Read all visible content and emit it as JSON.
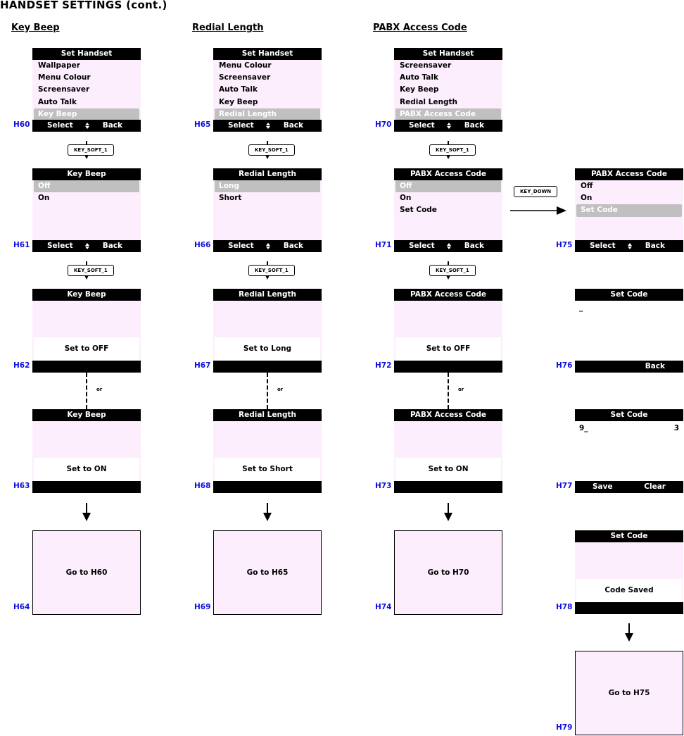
{
  "page_title": "HANDSET SETTINGS (cont.)",
  "sections": [
    {
      "title": "Key Beep"
    },
    {
      "title": "Redial Length"
    },
    {
      "title": "PABX Access Code"
    }
  ],
  "key_labels": {
    "soft1": "KEY_SOFT_1",
    "down": "KEY_DOWN"
  },
  "or_label": "or",
  "softkeys": {
    "select": "Select",
    "back": "Back",
    "nav": "▲▼",
    "save": "Save",
    "clear": "Clear"
  },
  "screens": {
    "H60": {
      "id": "H60",
      "title": "Set Handset",
      "items": [
        "Wallpaper",
        "Menu Colour",
        "Screensaver",
        "Auto Talk",
        "Key Beep"
      ],
      "selected": 4
    },
    "H61": {
      "id": "H61",
      "title": "Key Beep",
      "items": [
        "Off",
        "On"
      ],
      "selected": 0
    },
    "H62": {
      "id": "H62",
      "title": "Key Beep",
      "message": "Set to OFF"
    },
    "H63": {
      "id": "H63",
      "title": "Key Beep",
      "message": "Set to ON"
    },
    "H64": {
      "id": "H64",
      "message": "Go to H60"
    },
    "H65": {
      "id": "H65",
      "title": "Set Handset",
      "items": [
        "Menu Colour",
        "Screensaver",
        "Auto Talk",
        "Key Beep",
        "Redial Length"
      ],
      "selected": 4
    },
    "H66": {
      "id": "H66",
      "title": "Redial Length",
      "items": [
        "Long",
        "Short"
      ],
      "selected": 0
    },
    "H67": {
      "id": "H67",
      "title": "Redial Length",
      "message": "Set to Long"
    },
    "H68": {
      "id": "H68",
      "title": "Redial Length",
      "message": "Set to Short"
    },
    "H69": {
      "id": "H69",
      "message": "Go to H65"
    },
    "H70": {
      "id": "H70",
      "title": "Set Handset",
      "items": [
        "Screensaver",
        "Auto Talk",
        "Key Beep",
        "Redial Length",
        "PABX Access Code"
      ],
      "selected": 4
    },
    "H71": {
      "id": "H71",
      "title": "PABX Access Code",
      "items": [
        "Off",
        "On",
        "Set Code"
      ],
      "selected": 0
    },
    "H72": {
      "id": "H72",
      "title": "PABX Access Code",
      "message": "Set to OFF"
    },
    "H73": {
      "id": "H73",
      "title": "PABX Access Code",
      "message": "Set to ON"
    },
    "H74": {
      "id": "H74",
      "message": "Go to H70"
    },
    "H75": {
      "id": "H75",
      "title": "PABX Access Code",
      "items": [
        "Off",
        "On",
        "Set Code"
      ],
      "selected": 2
    },
    "H76": {
      "id": "H76",
      "title": "Set Code",
      "entry": "_"
    },
    "H77": {
      "id": "H77",
      "title": "Set Code",
      "entry": "9_",
      "count": "3"
    },
    "H78": {
      "id": "H78",
      "title": "Set Code",
      "message": "Code Saved"
    },
    "H79": {
      "id": "H79",
      "message": "Go to H75"
    }
  }
}
